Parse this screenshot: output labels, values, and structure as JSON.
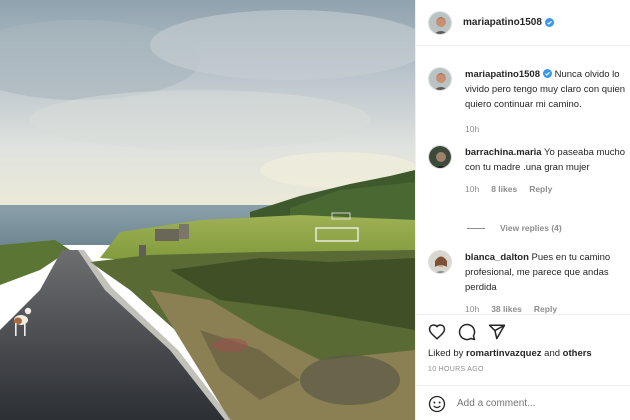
{
  "post": {
    "author": "mariapatino1508",
    "verified": true
  },
  "caption": {
    "user": "mariapatino1508",
    "text": "Nunca olvido lo vivido pero tengo muy claro con quien quiero continuar mi camino.",
    "time": "10h"
  },
  "comments": [
    {
      "user": "barrachina.maria",
      "text": "Yo paseaba mucho con tu madre .una gran mujer",
      "time": "10h",
      "likes": "8 likes",
      "reply": "Reply",
      "view_replies": "View replies (4)"
    },
    {
      "user": "blanca_dalton",
      "text": "Pues en tu camino profesional, me parece que andas perdida",
      "time": "10h",
      "likes": "38 likes",
      "reply": "Reply"
    }
  ],
  "liked_by": {
    "prefix": "Liked by",
    "user": "romartinvazquez",
    "connector": "and",
    "others": "others"
  },
  "timestamp": "10 HOURS AGO",
  "add_comment": {
    "placeholder": "Add a comment..."
  },
  "colors": {
    "verified": "#3897f0",
    "secondary_text": "#8e8e8e",
    "divider": "#efefef"
  },
  "icons": {
    "like": "heart-icon",
    "comment": "comment-icon",
    "share": "share-icon",
    "emoji": "smiley-icon"
  }
}
